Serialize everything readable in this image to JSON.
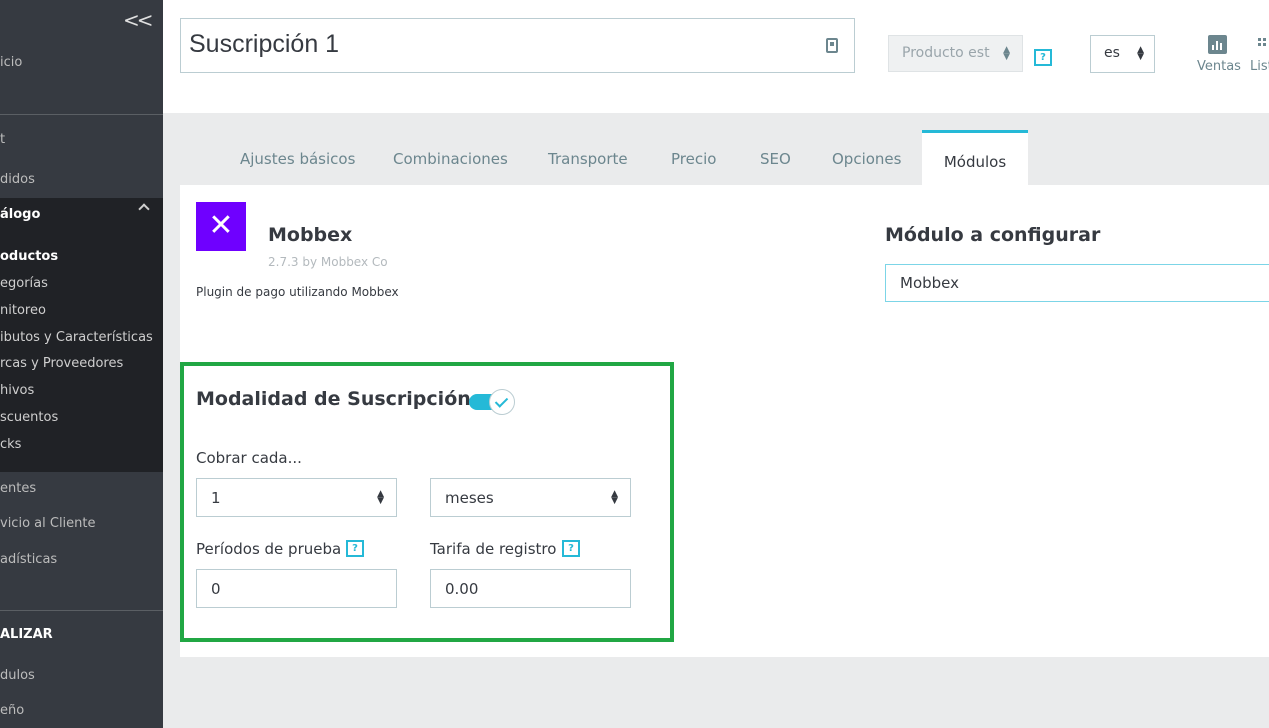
{
  "sidebar": {
    "top_item": "icio",
    "orders": "didos",
    "catalog": "álogo",
    "sub_items": [
      "oductos",
      "egorías",
      "nitoreo",
      "ibutos y Características",
      "rcas y Proveedores",
      "hivos",
      "scuentos",
      "cks"
    ],
    "clients": "entes",
    "service": "vicio al Cliente",
    "stats": "adísticas",
    "section_label": "ALIZAR",
    "modules": "dulos",
    "design": "eño",
    "first_label": "t"
  },
  "header": {
    "product_name": "Suscripción 1",
    "status_select": "Producto est",
    "help": "?",
    "language": "es",
    "sales_label": "Ventas",
    "list_label": "List"
  },
  "tabs": {
    "items": [
      "Ajustes básicos",
      "Combinaciones",
      "Transporte",
      "Precio",
      "SEO",
      "Opciones"
    ],
    "active": "Módulos"
  },
  "module": {
    "name": "Mobbex",
    "version": "2.7.3 by Mobbex Co",
    "description": "Plugin de pago utilizando Mobbex",
    "config_title": "Módulo a configurar",
    "config_value": "Mobbex"
  },
  "subscription": {
    "title": "Modalidad de Suscripción",
    "toggle_on": true,
    "charge_label": "Cobrar cada...",
    "charge_amount": "1",
    "charge_unit": "meses",
    "trial_label": "Períodos de prueba",
    "trial_value": "0",
    "fee_label": "Tarifa de registro",
    "fee_value": "0.00",
    "help": "?"
  },
  "colors": {
    "accent": "#25b9d7",
    "highlight": "#21a744",
    "logo": "#6f00ff",
    "sidebar": "#363a41"
  }
}
